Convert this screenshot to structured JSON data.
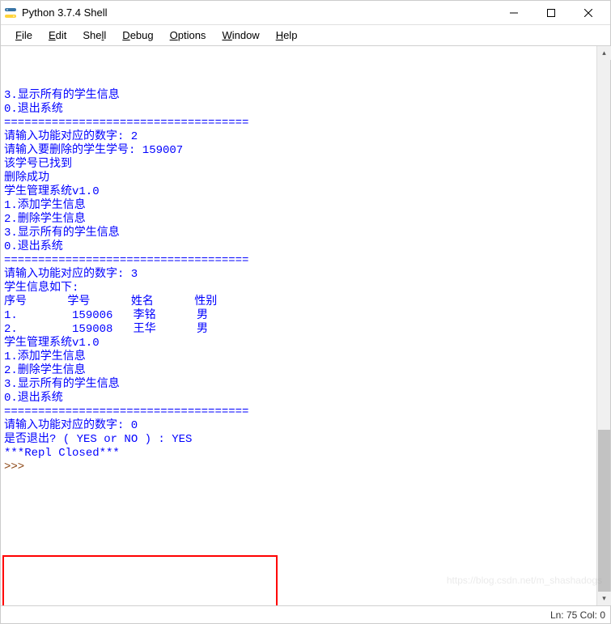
{
  "window": {
    "title": "Python 3.7.4 Shell"
  },
  "menu": {
    "file": "File",
    "edit": "Edit",
    "shell": "Shell",
    "debug": "Debug",
    "options": "Options",
    "window": "Window",
    "help": "Help"
  },
  "console": {
    "lines": [
      "3.显示所有的学生信息",
      "0.退出系统",
      "",
      "====================================",
      "请输入功能对应的数字: 2",
      "请输入要删除的学生学号: 159007",
      "该学号已找到",
      "删除成功",
      "",
      "学生管理系统v1.0",
      "1.添加学生信息",
      "2.删除学生信息",
      "3.显示所有的学生信息",
      "0.退出系统",
      "",
      "====================================",
      "请输入功能对应的数字: 3",
      "",
      "学生信息如下:",
      "",
      "序号      学号      姓名      性别",
      "",
      "",
      "1.        159006   李铭      男",
      "",
      "",
      "",
      "2.        159008   王华      男",
      "",
      "",
      "",
      "",
      "学生管理系统v1.0",
      "1.添加学生信息",
      "2.删除学生信息",
      "3.显示所有的学生信息",
      "0.退出系统",
      "====================================",
      "请输入功能对应的数字: 0",
      "是否退出? ( YES or NO ) : YES",
      "***Repl Closed***"
    ],
    "prompt": ">>> "
  },
  "status": {
    "text": "Ln: 75  Col: 0"
  },
  "watermark": "https://blog.csdn.net/m_shashadogs"
}
